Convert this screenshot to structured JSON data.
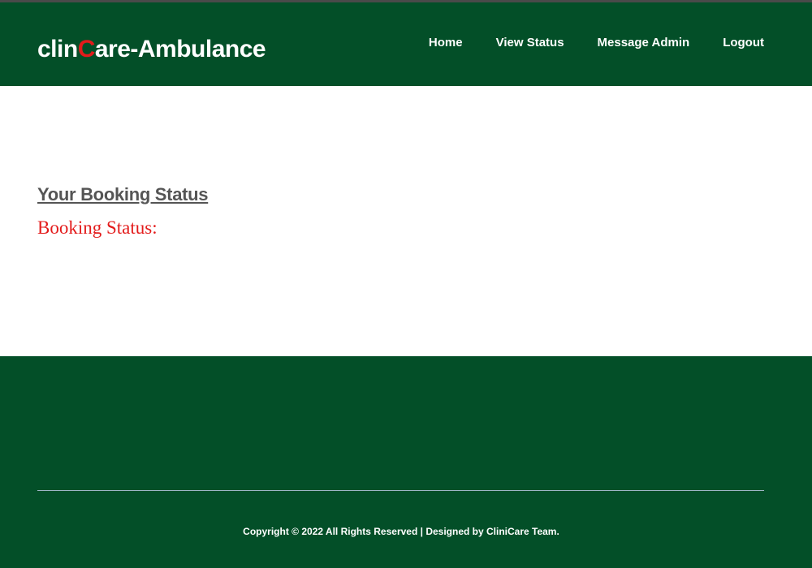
{
  "header": {
    "brand_prefix": "clin",
    "brand_accent": "C",
    "brand_suffix": "are-Ambulance",
    "nav": [
      {
        "label": "Home"
      },
      {
        "label": "View Status"
      },
      {
        "label": "Message Admin"
      },
      {
        "label": "Logout"
      }
    ]
  },
  "main": {
    "title": "Your Booking Status",
    "status_label": "Booking Status:"
  },
  "footer": {
    "copyright": "Copyright © 2022 All Rights Reserved | Designed by CliniCare Team."
  },
  "colors": {
    "header_bg": "#034f28",
    "footer_bg": "#034f28",
    "accent_red": "#e31b1b",
    "title_gray": "#555555"
  }
}
